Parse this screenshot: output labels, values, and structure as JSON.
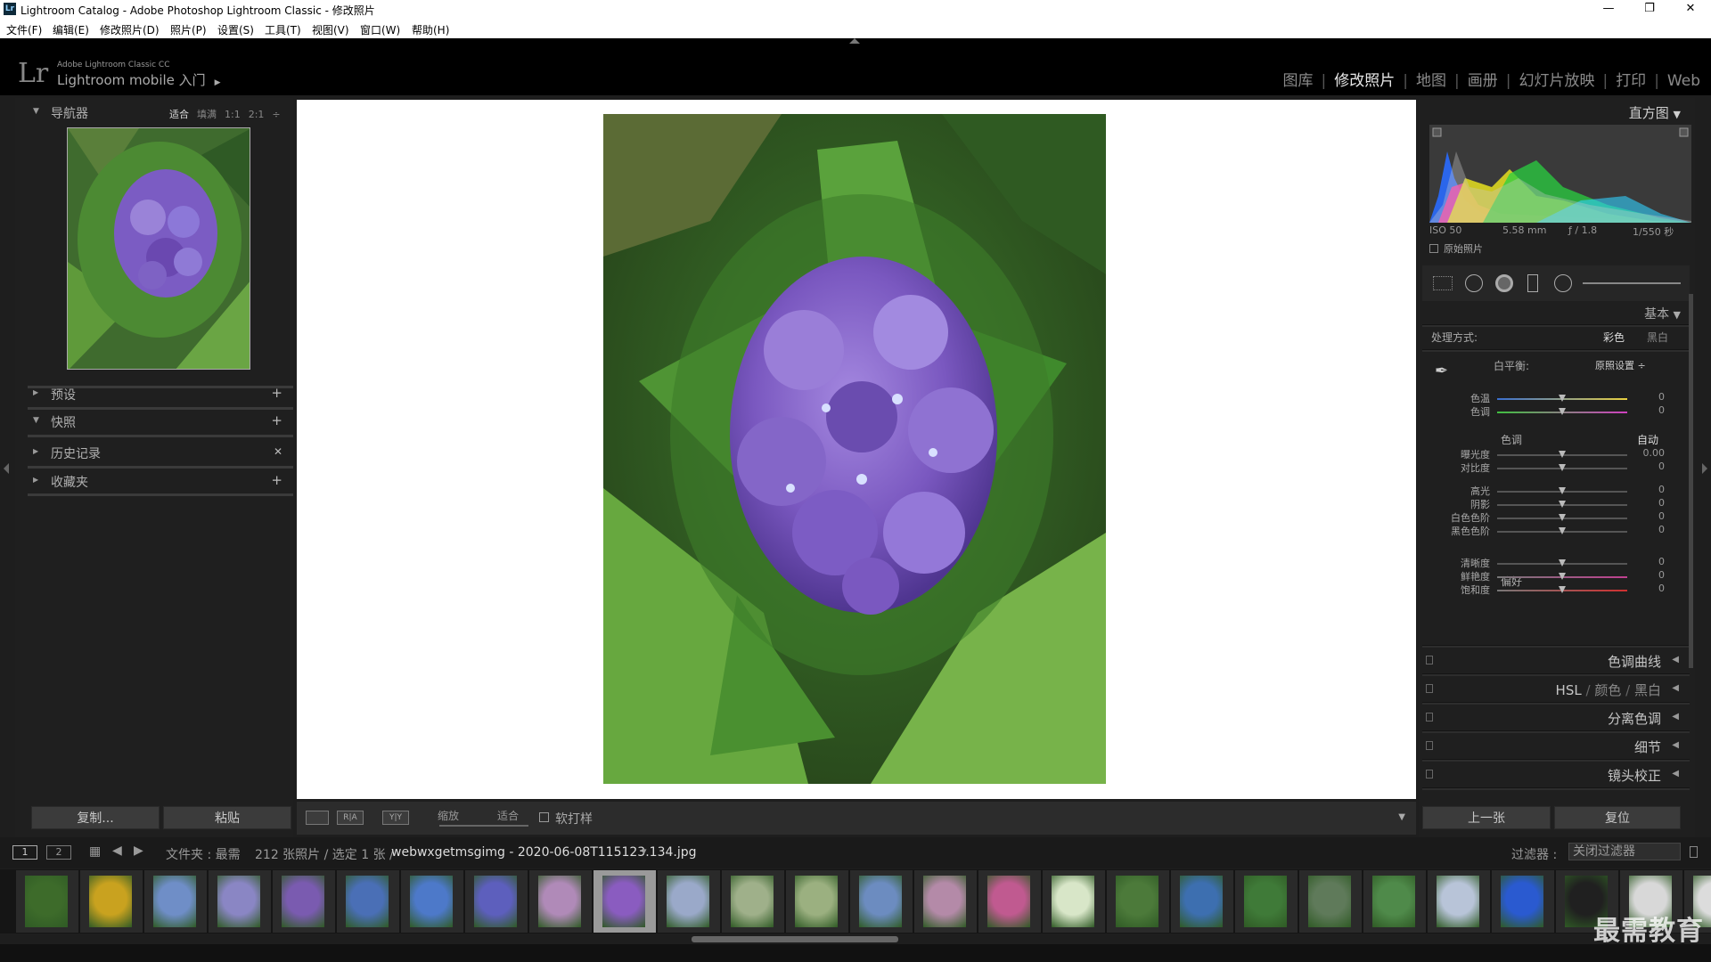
{
  "window": {
    "title": "Lightroom Catalog - Adobe Photoshop Lightroom Classic - 修改照片",
    "app_icon": "Lr",
    "controls": [
      "—",
      "❐",
      "✕"
    ]
  },
  "menu": [
    "文件(F)",
    "编辑(E)",
    "修改照片(D)",
    "照片(P)",
    "设置(S)",
    "工具(T)",
    "视图(V)",
    "窗口(W)",
    "帮助(H)"
  ],
  "header": {
    "logo": "Lr",
    "brand_top": "Adobe Lightroom Classic CC",
    "brand_main": "Lightroom mobile 入门",
    "brand_arrow": "▶",
    "modules": [
      {
        "label": "图库",
        "active": false
      },
      {
        "label": "修改照片",
        "active": true
      },
      {
        "label": "地图",
        "active": false
      },
      {
        "label": "画册",
        "active": false
      },
      {
        "label": "幻灯片放映",
        "active": false
      },
      {
        "label": "打印",
        "active": false
      },
      {
        "label": "Web",
        "active": false
      }
    ]
  },
  "left_panel": {
    "navigator": {
      "label": "导航器",
      "zoom": [
        "适合",
        "填满",
        "1:1",
        "2:1"
      ],
      "zoom_active": "适合",
      "zoom_more": "÷"
    },
    "sections": [
      {
        "label": "预设",
        "action": "+"
      },
      {
        "label": "快照",
        "action": "+"
      },
      {
        "label": "历史记录",
        "action": "✕"
      },
      {
        "label": "收藏夹",
        "action": "+"
      }
    ],
    "copy_button": "复制...",
    "paste_button": "粘贴"
  },
  "toolbar": {
    "zoom_label": "缩放",
    "zoom_value": "适合",
    "softproof_label": "软打样",
    "view_ra": "R|A",
    "view_yy": "Y|Y"
  },
  "right_panel": {
    "histogram_title": "直方图",
    "exif": {
      "iso": "ISO 50",
      "focal": "5.58 mm",
      "aperture": "ƒ / 1.8",
      "shutter": "1/550 秒"
    },
    "original_photo_label": "原始照片",
    "basic_title": "基本",
    "treatment_label": "处理方式:",
    "treatment_color": "彩色",
    "treatment_bw": "黑白",
    "wb_label": "白平衡:",
    "wb_value": "原照设置 ÷",
    "tone_label": "色调",
    "auto_label": "自动",
    "presence_label": "偏好",
    "sliders": [
      {
        "label": "色温",
        "value": "0",
        "pos": 0.5
      },
      {
        "label": "色调",
        "value": "0",
        "pos": 0.5
      },
      {
        "label": "曝光度",
        "value": "0.00",
        "pos": 0.5
      },
      {
        "label": "对比度",
        "value": "0",
        "pos": 0.5
      },
      {
        "label": "高光",
        "value": "0",
        "pos": 0.5
      },
      {
        "label": "阴影",
        "value": "0",
        "pos": 0.5
      },
      {
        "label": "白色色阶",
        "value": "0",
        "pos": 0.5
      },
      {
        "label": "黑色色阶",
        "value": "0",
        "pos": 0.5
      },
      {
        "label": "清晰度",
        "value": "0",
        "pos": 0.5
      },
      {
        "label": "鲜艳度",
        "value": "0",
        "pos": 0.5
      },
      {
        "label": "饱和度",
        "value": "0",
        "pos": 0.5
      }
    ],
    "collapsed_sections": [
      "色调曲线",
      "分离色调",
      "细节",
      "镜头校正"
    ],
    "hsl": {
      "a": "HSL",
      "sep": "/",
      "b": "颜色",
      "c": "黑白"
    },
    "prev_button": "上一张",
    "reset_button": "复位"
  },
  "filmstrip_bar": {
    "screen1": "1",
    "screen2": "2",
    "folder_label": "文件夹 : 最需",
    "count": "212 张照片 / 选定 1 张 /",
    "filename": "webwxgetmsgimg - 2020-06-08T115123.134.jpg",
    "filename_arrow": "▾",
    "filter_label": "过滤器 :",
    "filter_value": "关闭过滤器"
  },
  "filmstrip": {
    "selected_index": 9,
    "thumbs": [
      "#3d6b2a",
      "#c9a21f",
      "#6f8ec7",
      "#8a86c4",
      "#7a5bb0",
      "#4a6fb6",
      "#4d79c9",
      "#5d5fbd",
      "#b08ab8",
      "#8a5cc0",
      "#9aa9c9",
      "#9fb08a",
      "#9bb080",
      "#6c8cc0",
      "#b48aa8",
      "#c05a90",
      "#d8e6c8",
      "#4c7a3a",
      "#3d6fb0",
      "#3f7a38",
      "#5f7a5a",
      "#4f8a4a",
      "#b8c4d8",
      "#2a5ad0",
      "#202020",
      "#d8d8d8",
      "#dcdcdc"
    ]
  },
  "watermark": "最需教育",
  "colors": {
    "accent": "#e8e8e8",
    "panel": "#1f1f1f",
    "canvas": "#ffffff"
  }
}
